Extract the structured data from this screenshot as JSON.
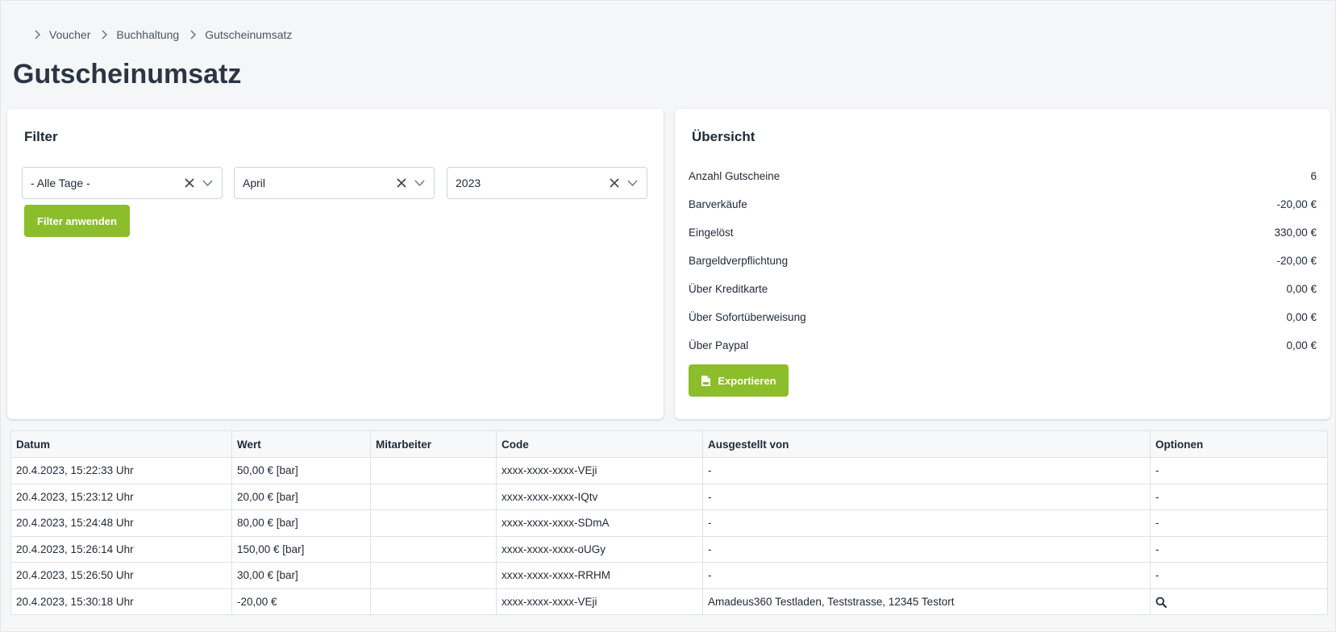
{
  "breadcrumb": {
    "items": [
      {
        "label": "Voucher"
      },
      {
        "label": "Buchhaltung"
      },
      {
        "label": "Gutscheinumsatz"
      }
    ]
  },
  "page": {
    "title": "Gutscheinumsatz"
  },
  "filter": {
    "title": "Filter",
    "day_select": {
      "value": "- Alle Tage -"
    },
    "month_select": {
      "value": "April"
    },
    "year_select": {
      "value": "2023"
    },
    "apply_label": "Filter anwenden"
  },
  "overview": {
    "title": "Übersicht",
    "rows": [
      {
        "label": "Anzahl Gutscheine",
        "value": "6"
      },
      {
        "label": "Barverkäufe",
        "value": "-20,00 €"
      },
      {
        "label": "Eingelöst",
        "value": "330,00 €"
      },
      {
        "label": "Bargeldverpflichtung",
        "value": "-20,00 €"
      },
      {
        "label": "Über Kreditkarte",
        "value": "0,00 €"
      },
      {
        "label": "Über Sofortüberweisung",
        "value": "0,00 €"
      },
      {
        "label": "Über Paypal",
        "value": "0,00 €"
      }
    ],
    "export_label": "Exportieren",
    "export_icon": "file-pdf-icon"
  },
  "table": {
    "headers": [
      "Datum",
      "Wert",
      "Mitarbeiter",
      "Code",
      "Ausgestellt von",
      "Optionen"
    ],
    "rows": [
      {
        "datum": "20.4.2023, 15:22:33 Uhr",
        "wert": "50,00 € [bar]",
        "mitarbeiter": "",
        "code": "xxxx-xxxx-xxxx-VEji",
        "ausgestellt": "-",
        "optionen": "-"
      },
      {
        "datum": "20.4.2023, 15:23:12 Uhr",
        "wert": "20,00 € [bar]",
        "mitarbeiter": "",
        "code": "xxxx-xxxx-xxxx-IQtv",
        "ausgestellt": "-",
        "optionen": "-"
      },
      {
        "datum": "20.4.2023, 15:24:48 Uhr",
        "wert": "80,00 € [bar]",
        "mitarbeiter": "",
        "code": "xxxx-xxxx-xxxx-SDmA",
        "ausgestellt": "-",
        "optionen": "-"
      },
      {
        "datum": "20.4.2023, 15:26:14 Uhr",
        "wert": "150,00 € [bar]",
        "mitarbeiter": "",
        "code": "xxxx-xxxx-xxxx-oUGy",
        "ausgestellt": "-",
        "optionen": "-"
      },
      {
        "datum": "20.4.2023, 15:26:50 Uhr",
        "wert": "30,00 € [bar]",
        "mitarbeiter": "",
        "code": "xxxx-xxxx-xxxx-RRHM",
        "ausgestellt": "-",
        "optionen": "-"
      },
      {
        "datum": "20.4.2023, 15:30:18 Uhr",
        "wert": "-20,00 €",
        "mitarbeiter": "",
        "code": "xxxx-xxxx-xxxx-VEji",
        "ausgestellt": "Amadeus360 Testladen, Teststrasse, 12345 Testort",
        "optionen": "",
        "optionen_icon": "search-icon"
      }
    ]
  },
  "colors": {
    "accent_green": "#8cbd2a",
    "title_text": "#2b3544",
    "background": "#f5f6f8"
  }
}
